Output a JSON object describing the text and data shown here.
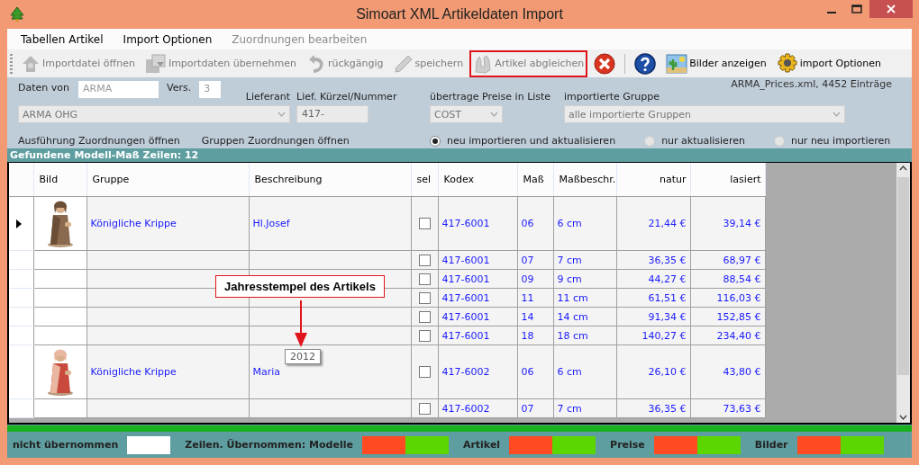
{
  "window": {
    "title": "Simoart XML Artikeldaten Import"
  },
  "menu": [
    {
      "label": "Tabellen Artikel",
      "disabled": false
    },
    {
      "label": "Import Optionen",
      "disabled": false
    },
    {
      "label": "Zuordnungen bearbeiten",
      "disabled": true
    }
  ],
  "toolbar": [
    {
      "kind": "button",
      "label": "Importdatei öffnen",
      "disabled": true,
      "highlighted": false
    },
    {
      "kind": "button",
      "label": "Importdaten übernehmen",
      "disabled": true,
      "highlighted": false
    },
    {
      "kind": "button",
      "label": "rückgängig",
      "disabled": true,
      "highlighted": false
    },
    {
      "kind": "button",
      "label": "speichern",
      "disabled": true,
      "highlighted": false
    },
    {
      "kind": "button",
      "label": "Artikel abgleichen",
      "disabled": true,
      "highlighted": true
    },
    {
      "kind": "icon",
      "disabled": false,
      "highlighted": false
    },
    {
      "kind": "separator"
    },
    {
      "kind": "icon",
      "disabled": false,
      "highlighted": false
    },
    {
      "kind": "button",
      "label": "Bilder anzeigen",
      "disabled": false,
      "highlighted": false
    },
    {
      "kind": "button",
      "label": "import Optionen",
      "disabled": false,
      "highlighted": false
    }
  ],
  "form": {
    "source_label": "Daten von",
    "source_value": "ARMA",
    "version_label": "Vers.",
    "version_value": "3",
    "supplier_label": "Lieferant",
    "supplier_value": "ARMA OHG",
    "code_label": "Lief. Kürzel/Nummer",
    "code_value": "417-",
    "price_list_label": "übertrage Preise in Liste",
    "price_list_value": "COST",
    "group_label": "importierte Gruppe",
    "group_value": "alle importierte Gruppen",
    "file_info": "ARMA_Prices.xml, 4452 Einträge",
    "links": [
      "Ausführung Zuordnungen öffnen",
      "Gruppen Zuordnungen öffnen"
    ],
    "modes": [
      {
        "label": "neu importieren und aktualisieren",
        "selected": true
      },
      {
        "label": "nur aktualisieren",
        "selected": false
      },
      {
        "label": "nur neu importieren",
        "selected": false
      }
    ]
  },
  "found_header": "Gefundene Modell-Maß Zeilen: 12",
  "table": {
    "columns": [
      "Bild",
      "Gruppe",
      "Beschreibung",
      "sel",
      "Kodex",
      "Maß",
      "Maßbeschr.",
      "natur",
      "lasiert"
    ],
    "rows": [
      {
        "current": true,
        "has_picture": true,
        "group": "Königliche Krippe",
        "description": "Hl.Josef",
        "checked": false,
        "code": "417-6001",
        "size": "06",
        "size_label": "6 cm",
        "natur": "21,44 €",
        "lasiert": "39,14 €"
      },
      {
        "current": false,
        "has_picture": false,
        "checked": false,
        "code": "417-6001",
        "size": "07",
        "size_label": "7 cm",
        "natur": "36,35 €",
        "lasiert": "68,97 €"
      },
      {
        "current": false,
        "has_picture": false,
        "checked": false,
        "code": "417-6001",
        "size": "09",
        "size_label": "9 cm",
        "natur": "44,27 €",
        "lasiert": "88,54 €"
      },
      {
        "current": false,
        "has_picture": false,
        "checked": false,
        "code": "417-6001",
        "size": "11",
        "size_label": "11 cm",
        "natur": "61,51 €",
        "lasiert": "116,03 €"
      },
      {
        "current": false,
        "has_picture": false,
        "checked": false,
        "code": "417-6001",
        "size": "14",
        "size_label": "14 cm",
        "natur": "91,34 €",
        "lasiert": "152,85 €"
      },
      {
        "current": false,
        "has_picture": false,
        "checked": false,
        "code": "417-6001",
        "size": "18",
        "size_label": "18 cm",
        "natur": "140,27 €",
        "lasiert": "234,40 €"
      },
      {
        "current": false,
        "has_picture": true,
        "group": "Königliche Krippe",
        "description": "Maria",
        "checked": false,
        "code": "417-6002",
        "size": "06",
        "size_label": "6 cm",
        "natur": "26,10 €",
        "lasiert": "43,80 €"
      },
      {
        "current": false,
        "has_picture": false,
        "checked": false,
        "code": "417-6002",
        "size": "07",
        "size_label": "7 cm",
        "natur": "36,35 €",
        "lasiert": "73,63 €"
      }
    ]
  },
  "callout": "Jahresstempel des Artikels",
  "tooltip": "2012",
  "progress": {
    "level": 1
  },
  "legend": [
    {
      "kind": "label",
      "text": "nicht übernommen"
    },
    {
      "kind": "swatch",
      "color": "#ffffff"
    },
    {
      "kind": "label",
      "text": "Zeilen. Übernommen: Modelle"
    },
    {
      "kind": "swatch",
      "color": "#ff4b22"
    },
    {
      "kind": "swatch",
      "color": "#5cd600"
    },
    {
      "kind": "label",
      "text": "Artikel"
    },
    {
      "kind": "swatch",
      "color": "#ff4b22"
    },
    {
      "kind": "swatch",
      "color": "#5cd600"
    },
    {
      "kind": "label",
      "text": "Preise"
    },
    {
      "kind": "swatch",
      "color": "#ff4b22"
    },
    {
      "kind": "swatch",
      "color": "#5cd600"
    },
    {
      "kind": "label",
      "text": "Bilder"
    },
    {
      "kind": "swatch",
      "color": "#ff4b22"
    },
    {
      "kind": "swatch",
      "color": "#5cd600"
    }
  ]
}
